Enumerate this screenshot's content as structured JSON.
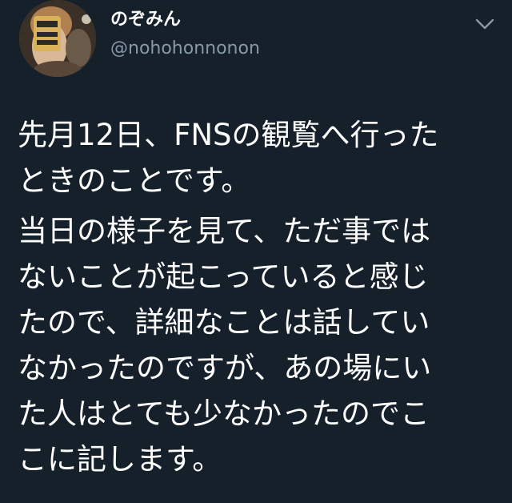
{
  "tweet": {
    "display_name": "のぞみん",
    "handle": "@nohohonnonon",
    "menu_icon": "chevron-down-icon",
    "avatar_icon": "user-avatar",
    "paragraphs": [
      [
        "先月12日、FNSの観覧へ行った",
        "ときのことです。"
      ],
      [
        "当日の様子を見て、ただ事では",
        "ないことが起こっていると感じ",
        "たので、詳細なことは話してい",
        "なかったのですが、あの場にい",
        "た人はとても少なかったのでこ",
        "こに記します。"
      ]
    ]
  },
  "colors": {
    "background": "#15202b",
    "text": "#ffffff",
    "secondary_text": "#8899a6"
  }
}
